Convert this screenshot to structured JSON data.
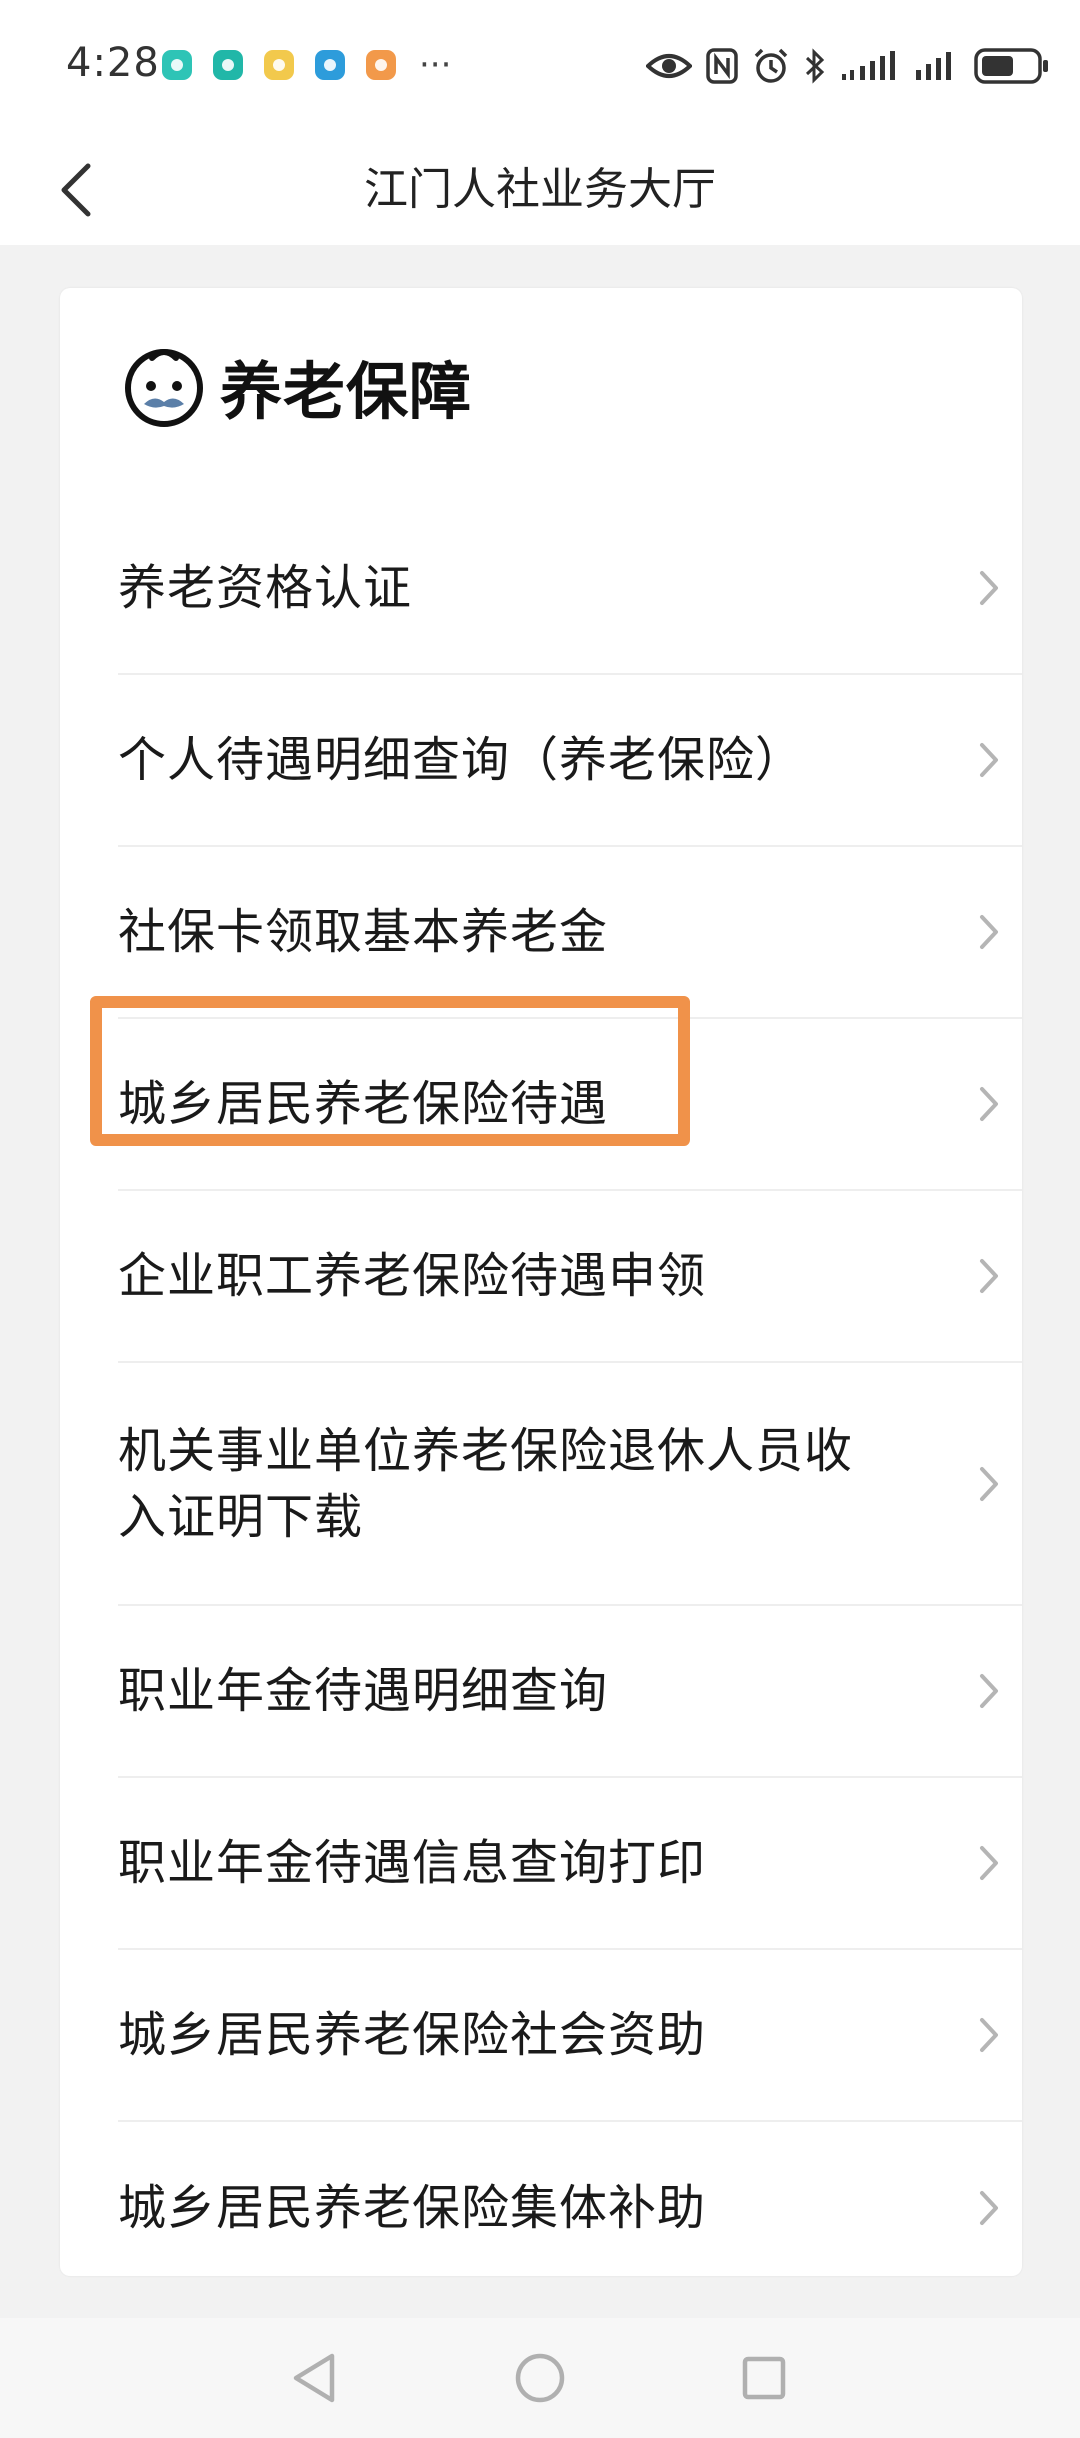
{
  "status_bar": {
    "time": "4:28",
    "notification_icons": [
      {
        "name": "app-notification-icon-1",
        "color": "#2ec4b6"
      },
      {
        "name": "app-notification-icon-2",
        "color": "#21b7a8"
      },
      {
        "name": "app-notification-icon-3",
        "color": "#f2c94c"
      },
      {
        "name": "app-notification-icon-4",
        "color": "#2d9cdb"
      },
      {
        "name": "app-notification-icon-5",
        "color": "#f2994a"
      }
    ],
    "more": "···",
    "battery_level": 0.6
  },
  "header": {
    "title": "江门人社业务大厅"
  },
  "section": {
    "title": "养老保障",
    "icon": "elderly-face-icon"
  },
  "menu": {
    "items": [
      {
        "label": "养老资格认证"
      },
      {
        "label": "个人待遇明细查询（养老保险）"
      },
      {
        "label": "社保卡领取基本养老金"
      },
      {
        "label": "城乡居民养老保险待遇"
      },
      {
        "label": "企业职工养老保险待遇申领"
      },
      {
        "label": "机关事业单位养老保险退休人员收入证明下载"
      },
      {
        "label": "职业年金待遇明细查询"
      },
      {
        "label": "职业年金待遇信息查询打印"
      },
      {
        "label": "城乡居民养老保险社会资助"
      },
      {
        "label": "城乡居民养老保险集体补助"
      }
    ]
  },
  "highlight": {
    "color": "#f0924a",
    "target_item_index": 3
  }
}
